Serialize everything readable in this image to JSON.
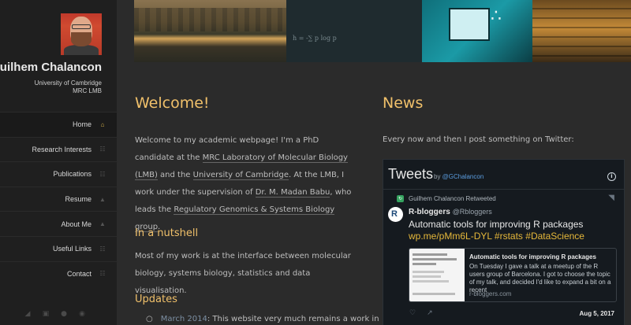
{
  "sidebar": {
    "name": "Guilhem Chalancon",
    "affiliation_line1": "University of Cambridge",
    "affiliation_line2": "MRC LMB",
    "nav": [
      {
        "label": "Home",
        "icon": "home-icon",
        "active": true
      },
      {
        "label": "Research Interests",
        "icon": "grid-icon"
      },
      {
        "label": "Publications",
        "icon": "grid-icon"
      },
      {
        "label": "Resume",
        "icon": "user-icon"
      },
      {
        "label": "About Me",
        "icon": "user-icon"
      },
      {
        "label": "Useful Links",
        "icon": "grid-icon"
      },
      {
        "label": "Contact",
        "icon": "grid-icon"
      }
    ],
    "socials": [
      "twitter-icon",
      "linkedin-icon",
      "github-icon",
      "researchgate-icon"
    ]
  },
  "main": {
    "welcome_title": "Welcome!",
    "intro_1": "Welcome to my academic webpage! I'm a PhD candidate at the ",
    "intro_link_1": "MRC Laboratory of Molecular Biology (LMB)",
    "intro_2": " and the ",
    "intro_link_2": "University of Cambridge",
    "intro_3": ". At the LMB, I work under the supervision of ",
    "intro_link_3": "Dr. M. Madan Babu",
    "intro_4": ", who leads the ",
    "intro_link_4": "Regulatory Genomics & Systems Biology group",
    "intro_5": ".",
    "nutshell_title": "In a nutshell",
    "nutshell_text": "Most of my work is at the interface between molecular biology, systems biology, statistics and data visualisation.",
    "updates_title": "Updates",
    "update_date": "March 2014",
    "update_text": ": This website very much remains a work in"
  },
  "news": {
    "title": "News",
    "intro": "Every now and then I post something on Twitter:",
    "widget": {
      "title": "Tweets",
      "by": "by ",
      "handle": "@GChalancon",
      "info": "i",
      "retweeted": "Guilhem Chalancon Retweeted",
      "user_name": "R-bloggers",
      "user_handle": "@Rbloggers",
      "tweet_text": "Automatic tools for improving R packages",
      "tweet_link": "wp.me/pMm6L-DYL #rstats #DataScience",
      "card_title": "Automatic tools for improving R packages",
      "card_desc": "On Tuesday I gave a talk at a meetup of the R users group of Barcelona. I got to choose the topic of my talk, and decided I'd like to expand a bit on a recent",
      "card_url": "r-bloggers.com",
      "date": "Aug 5, 2017"
    }
  },
  "banner": {
    "formula": "h = -∑ p log p"
  }
}
